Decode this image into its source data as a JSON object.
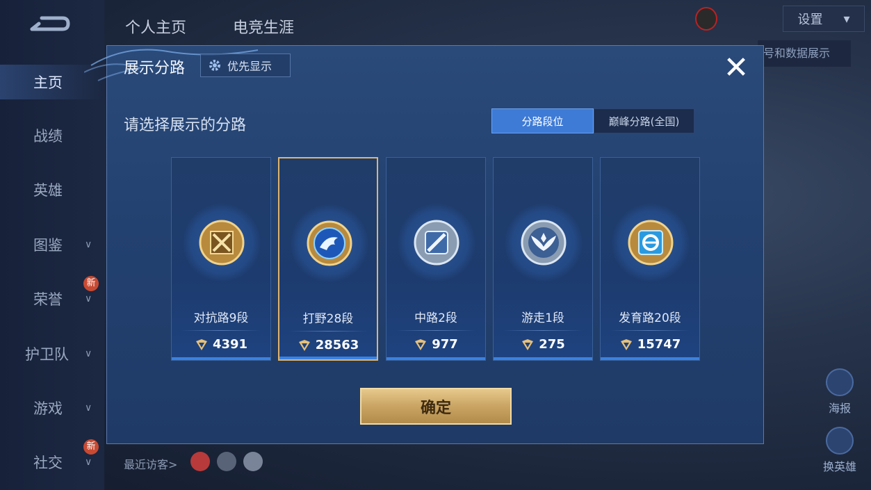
{
  "sidebar": {
    "items": [
      {
        "label": "主页",
        "active": true
      },
      {
        "label": "战绩"
      },
      {
        "label": "英雄"
      },
      {
        "label": "图鉴"
      },
      {
        "label": "荣誉",
        "badge": "新"
      },
      {
        "label": "护卫队"
      },
      {
        "label": "游戏"
      },
      {
        "label": "社交",
        "badge": "新"
      }
    ]
  },
  "header": {
    "tabs": [
      "个人主页",
      "电竞生涯"
    ],
    "settings_label": "设置"
  },
  "right_panel": {
    "hint_text": "号和数据展示",
    "poster_label": "海报",
    "switch_hero_label": "换英雄"
  },
  "footer": {
    "recent_visitors_label": "最近访客>"
  },
  "modal": {
    "title": "展示分路",
    "priority_label": "优先显示",
    "subtitle": "请选择展示的分路",
    "segments": [
      "分路段位",
      "巅峰分路(全国)"
    ],
    "cards": [
      {
        "name": "对抗路9段",
        "score": "4391",
        "icon": "clash-lane-sword-icon"
      },
      {
        "name": "打野28段",
        "score": "28563",
        "icon": "jungle-dragon-icon",
        "selected": true
      },
      {
        "name": "中路2段",
        "score": "977",
        "icon": "mid-lane-icon"
      },
      {
        "name": "游走1段",
        "score": "275",
        "icon": "roam-wings-icon"
      },
      {
        "name": "发育路20段",
        "score": "15747",
        "icon": "farm-lane-icon"
      }
    ],
    "confirm_label": "确定"
  },
  "colors": {
    "accent_blue": "#3e7bd6",
    "gold": "#e2b46a",
    "modal_bg": "#234170"
  }
}
